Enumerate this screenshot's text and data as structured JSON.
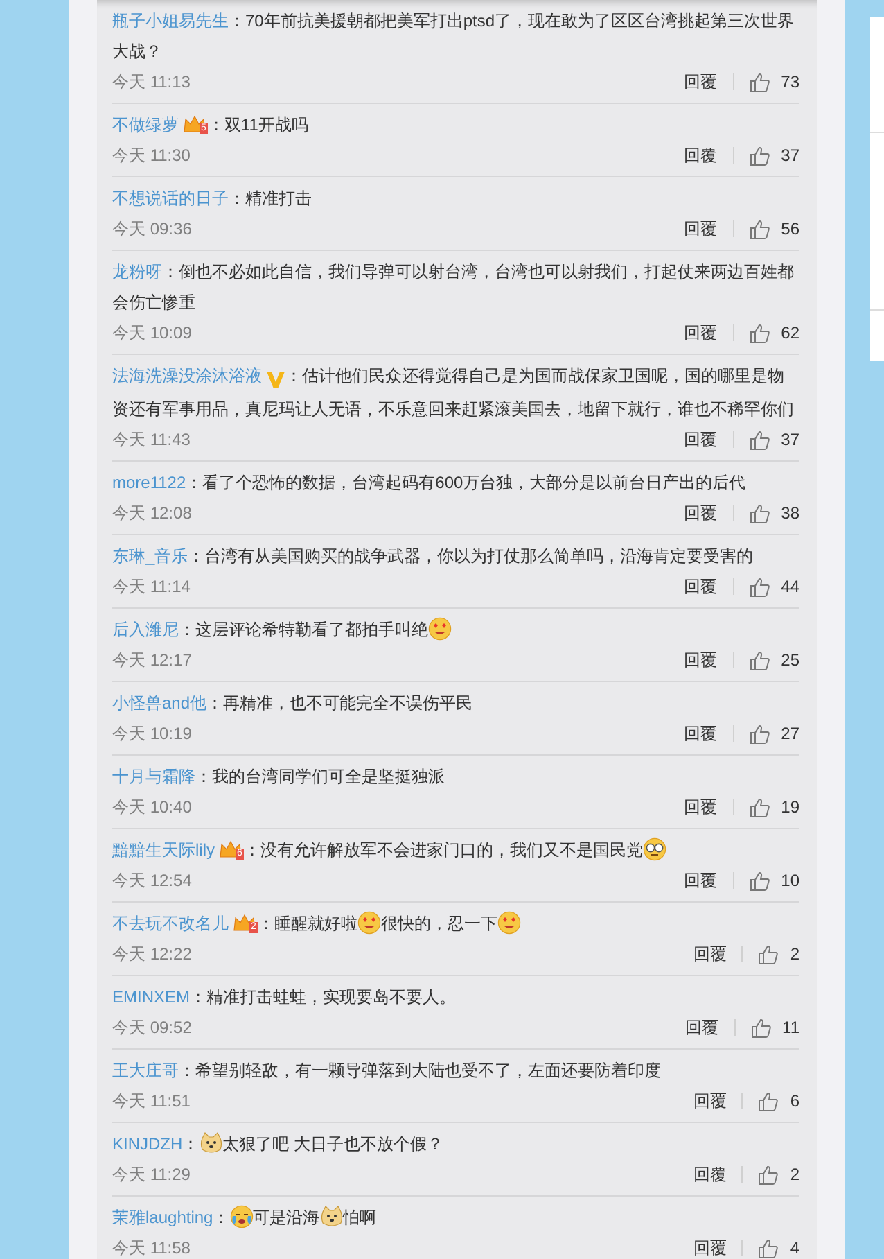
{
  "comments": [
    {
      "user": "瓶子小姐易先生",
      "content": [
        {
          "kind": "text",
          "text": "：70年前抗美援朝都把美军打出ptsd了，现在敢为了区区台湾挑起第三次世界"
        },
        {
          "kind": "text_line",
          "text": "大战？"
        }
      ],
      "time": "今天 11:13",
      "reply": "回覆",
      "likes": "73"
    },
    {
      "user": "不做绿萝",
      "badge": {
        "kind": "crown",
        "rank": "5"
      },
      "content": [
        {
          "kind": "text",
          "text": "：双11开战吗"
        }
      ],
      "time": "今天 11:30",
      "reply": "回覆",
      "likes": "37"
    },
    {
      "user": "不想说话的日子",
      "content": [
        {
          "kind": "text",
          "text": "：精准打击"
        }
      ],
      "time": "今天 09:36",
      "reply": "回覆",
      "likes": "56"
    },
    {
      "user": "龙粉呀",
      "content": [
        {
          "kind": "text",
          "text": "：倒也不必如此自信，我们导弹可以射台湾，台湾也可以射我们，打起仗来两边百姓都"
        },
        {
          "kind": "text_line",
          "text": "会伤亡惨重"
        }
      ],
      "time": "今天 10:09",
      "reply": "回覆",
      "likes": "62"
    },
    {
      "user": "法海洗澡没涂沐浴液",
      "badge": {
        "kind": "verified"
      },
      "content": [
        {
          "kind": "text",
          "text": "：估计他们民众还得觉得自己是为国而战保家卫国呢，国的哪里是物"
        },
        {
          "kind": "text_line",
          "text": "资还有军事用品，真尼玛让人无语，不乐意回来赶紧滚美国去，地留下就行，谁也不稀罕你们"
        }
      ],
      "time": "今天 11:43",
      "reply": "回覆",
      "likes": "37"
    },
    {
      "user": "more1122",
      "content": [
        {
          "kind": "text",
          "text": "：看了个恐怖的数据，台湾起码有600万台独，大部分是以前台日产出的后代"
        }
      ],
      "time": "今天 12:08",
      "reply": "回覆",
      "likes": "38"
    },
    {
      "user": "东琳_音乐",
      "content": [
        {
          "kind": "text",
          "text": "：台湾有从美国购买的战争武器，你以为打仗那么简单吗，沿海肯定要受害的"
        }
      ],
      "time": "今天 11:14",
      "reply": "回覆",
      "likes": "44"
    },
    {
      "user": "后入潍尼",
      "content": [
        {
          "kind": "text",
          "text": "：这层评论希特勒看了都拍手叫绝"
        },
        {
          "kind": "emoji_love"
        }
      ],
      "time": "今天 12:17",
      "reply": "回覆",
      "likes": "25"
    },
    {
      "user": "小怪兽and他",
      "content": [
        {
          "kind": "text",
          "text": "：再精准，也不可能完全不误伤平民"
        }
      ],
      "time": "今天 10:19",
      "reply": "回覆",
      "likes": "27"
    },
    {
      "user": "十月与霜降",
      "content": [
        {
          "kind": "text",
          "text": "：我的台湾同学们可全是坚挺独派"
        }
      ],
      "time": "今天 10:40",
      "reply": "回覆",
      "likes": "19"
    },
    {
      "user": "黯黯生天际lily",
      "badge": {
        "kind": "crown",
        "rank": "6"
      },
      "content": [
        {
          "kind": "text",
          "text": "：没有允许解放军不会进家门口的，我们又不是国民党"
        },
        {
          "kind": "emoji_glasses"
        }
      ],
      "time": "今天 12:54",
      "reply": "回覆",
      "likes": "10"
    },
    {
      "user": "不去玩不改名儿",
      "badge": {
        "kind": "crown",
        "rank": "2"
      },
      "content": [
        {
          "kind": "text",
          "text": "：睡醒就好啦"
        },
        {
          "kind": "emoji_love"
        },
        {
          "kind": "text",
          "text": "很快的，忍一下"
        },
        {
          "kind": "emoji_love"
        }
      ],
      "time": "今天 12:22",
      "reply": "回覆",
      "likes": "2"
    },
    {
      "user": "EMINXEM",
      "content": [
        {
          "kind": "text",
          "text": "：精准打击蛙蛙，实现要岛不要人。"
        }
      ],
      "time": "今天 09:52",
      "reply": "回覆",
      "likes": "11"
    },
    {
      "user": "王大庄哥",
      "content": [
        {
          "kind": "text",
          "text": "：希望别轻敌，有一颗导弹落到大陆也受不了，左面还要防着印度"
        }
      ],
      "time": "今天 11:51",
      "reply": "回覆",
      "likes": "6"
    },
    {
      "user": "KINJDZH",
      "content": [
        {
          "kind": "text",
          "text": "："
        },
        {
          "kind": "emoji_doge"
        },
        {
          "kind": "text",
          "text": "太狠了吧 大日子也不放个假？"
        }
      ],
      "time": "今天 11:29",
      "reply": "回覆",
      "likes": "2"
    },
    {
      "user": "茉雅laughting",
      "content": [
        {
          "kind": "text",
          "text": "："
        },
        {
          "kind": "emoji_cry"
        },
        {
          "kind": "text",
          "text": "可是沿海"
        },
        {
          "kind": "emoji_doge"
        },
        {
          "kind": "text",
          "text": "怕啊"
        }
      ],
      "time": "今天 11:58",
      "reply": "回覆",
      "likes": "4"
    }
  ]
}
